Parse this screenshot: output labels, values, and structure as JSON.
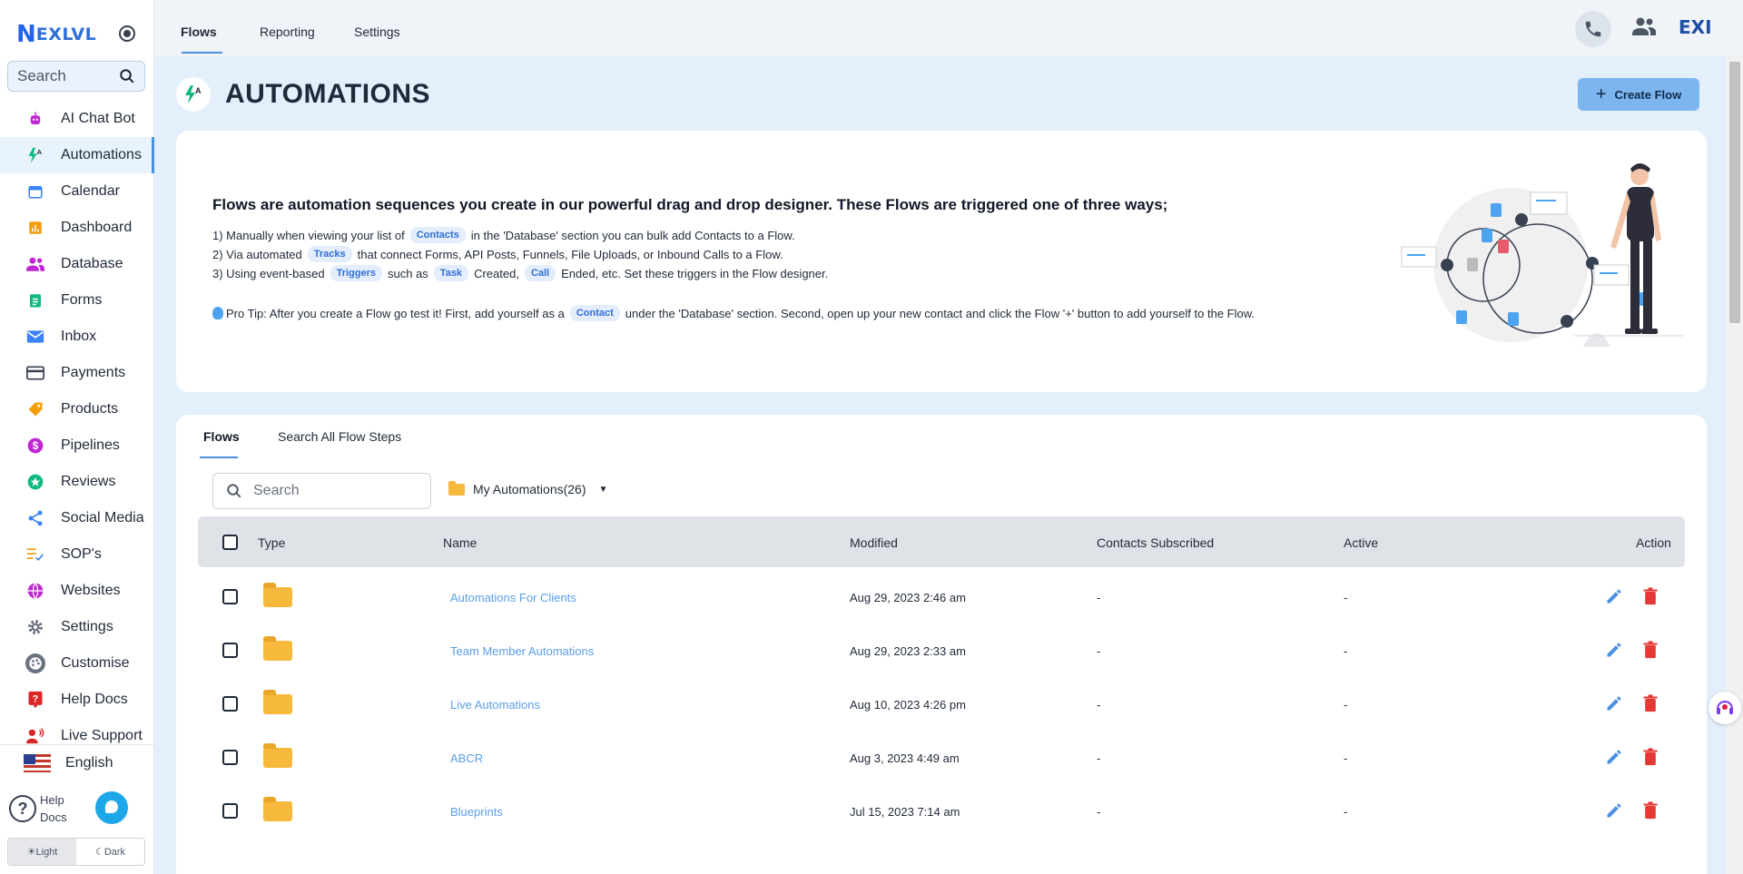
{
  "brand": {
    "logo_mark": "N",
    "logo_text": "EXLVL"
  },
  "sidebar": {
    "search_label": "Search",
    "items": [
      {
        "label": "AI Chat Bot",
        "icon": "robot-icon",
        "color": "#c026d3"
      },
      {
        "label": "Automations",
        "icon": "automation-bolt-icon",
        "color": "#10b981",
        "active": true
      },
      {
        "label": "Calendar",
        "icon": "calendar-icon",
        "color": "#3b82f6"
      },
      {
        "label": "Dashboard",
        "icon": "bar-chart-icon",
        "color": "#f59e0b"
      },
      {
        "label": "Database",
        "icon": "people-icon",
        "color": "#c026d3"
      },
      {
        "label": "Forms",
        "icon": "clipboard-icon",
        "color": "#10b981"
      },
      {
        "label": "Inbox",
        "icon": "mail-icon",
        "color": "#3b82f6"
      },
      {
        "label": "Payments",
        "icon": "credit-card-icon",
        "color": "#374151"
      },
      {
        "label": "Products",
        "icon": "tag-icon",
        "color": "#f59e0b"
      },
      {
        "label": "Pipelines",
        "icon": "dollar-circle-icon",
        "color": "#c026d3"
      },
      {
        "label": "Reviews",
        "icon": "star-circle-icon",
        "color": "#10b981"
      },
      {
        "label": "Social Media",
        "icon": "share-icon",
        "color": "#3b82f6"
      },
      {
        "label": "SOP's",
        "icon": "checklist-icon",
        "color": "#f59e0b"
      },
      {
        "label": "Websites",
        "icon": "globe-icon",
        "color": "#c026d3"
      },
      {
        "label": "Settings",
        "icon": "gear-icon",
        "color": "#6b7280"
      },
      {
        "label": "Customise",
        "icon": "palette-icon",
        "color": "#6b7280"
      },
      {
        "label": "Help Docs",
        "icon": "help-square-icon",
        "color": "#dc2626"
      },
      {
        "label": "Live Support",
        "icon": "support-agent-icon",
        "color": "#dc2626"
      }
    ],
    "language": "English",
    "help_docs": "Help Docs",
    "theme_light": "☀Light",
    "theme_dark": "☾Dark"
  },
  "topbar": {
    "tabs": [
      "Flows",
      "Reporting",
      "Settings"
    ],
    "brand_mini": "EXI"
  },
  "page": {
    "title": "AUTOMATIONS",
    "create_label": "Create Flow"
  },
  "info": {
    "heading": "Flows are automation sequences you create in our powerful drag and drop designer. These Flows are triggered one of three ways;",
    "line1": {
      "a": "1) Manually when viewing your list of",
      "chip": "Contacts",
      "b": "in the 'Database' section you can bulk add Contacts to a Flow."
    },
    "line2": {
      "a": "2) Via automated",
      "chip": "Tracks",
      "b": "that connect Forms, API Posts, Funnels, File Uploads, or Inbound Calls to a Flow."
    },
    "line3": {
      "a": "3) Using event-based",
      "chip1": "Triggers",
      "b": "such as",
      "chip2": "Task",
      "c": "Created,",
      "chip3": "Call",
      "d": "Ended, etc. Set these triggers in the Flow designer."
    },
    "tip": {
      "a": "Pro Tip: After you create a Flow go test it! First, add yourself as a",
      "chip": "Contact",
      "b": "under the 'Database' section. Second, open up your new contact and click the Flow '+' button to add yourself to the Flow."
    }
  },
  "flows": {
    "tabs": [
      "Flows",
      "Search All Flow Steps"
    ],
    "search_placeholder": "Search",
    "folder_select": "My Automations(26)",
    "columns": [
      "Type",
      "Name",
      "Modified",
      "Contacts Subscribed",
      "Active",
      "Action"
    ],
    "rows": [
      {
        "name": "Automations For Clients",
        "modified": "Aug 29, 2023 2:46 am",
        "contacts": "-",
        "active": "-"
      },
      {
        "name": "Team Member Automations",
        "modified": "Aug 29, 2023 2:33 am",
        "contacts": "-",
        "active": "-"
      },
      {
        "name": "Live Automations",
        "modified": "Aug 10, 2023 4:26 pm",
        "contacts": "-",
        "active": "-"
      },
      {
        "name": "ABCR",
        "modified": "Aug 3, 2023 4:49 am",
        "contacts": "-",
        "active": "-"
      },
      {
        "name": "Blueprints",
        "modified": "Jul 15, 2023 7:14 am",
        "contacts": "-",
        "active": "-"
      }
    ]
  },
  "colors": {
    "accent": "#4a90e2",
    "create_button": "#7db5ef",
    "folder": "#f6b93b",
    "delete": "#e53935",
    "edit": "#4a90e2"
  }
}
